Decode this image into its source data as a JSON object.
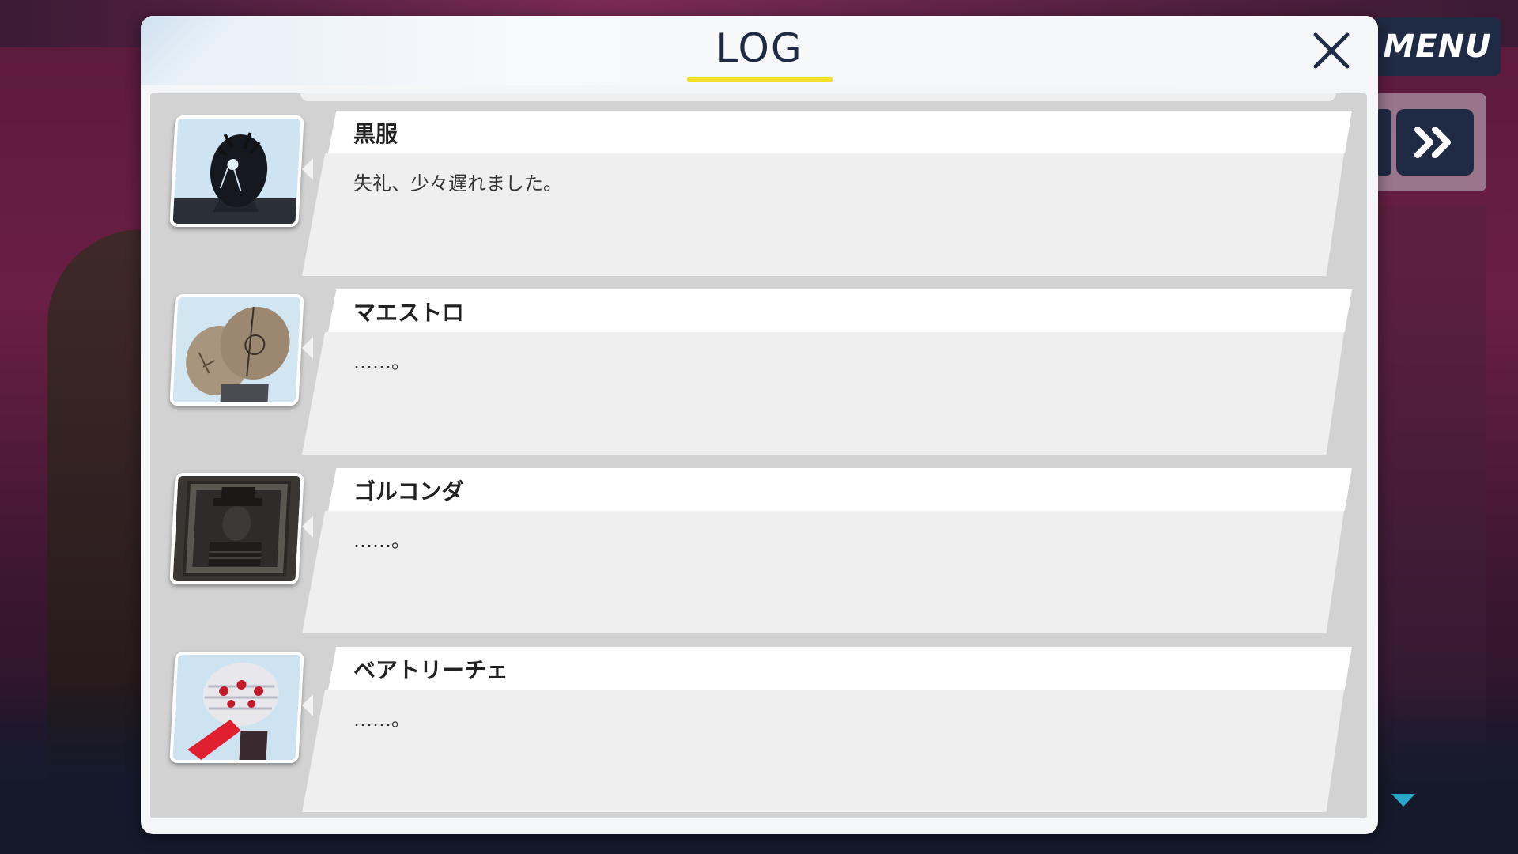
{
  "dialog": {
    "title": "LOG",
    "accent_color": "#f2e02a",
    "close_icon": "close-icon"
  },
  "controls": {
    "menu_label": "MENU",
    "skip_icon": "double-chevron-right-icon",
    "scroll_icon": "triangle-down-icon"
  },
  "entries": [
    {
      "speaker": "黒服",
      "message": "失礼、少々遅れました。",
      "avatar": "black-suit-avatar"
    },
    {
      "speaker": "マエストロ",
      "message": "……。",
      "avatar": "maestro-avatar"
    },
    {
      "speaker": "ゴルコンダ",
      "message": "……。",
      "avatar": "golconda-avatar"
    },
    {
      "speaker": "ベアトリーチェ",
      "message": "……。",
      "avatar": "beatrice-avatar"
    }
  ]
}
